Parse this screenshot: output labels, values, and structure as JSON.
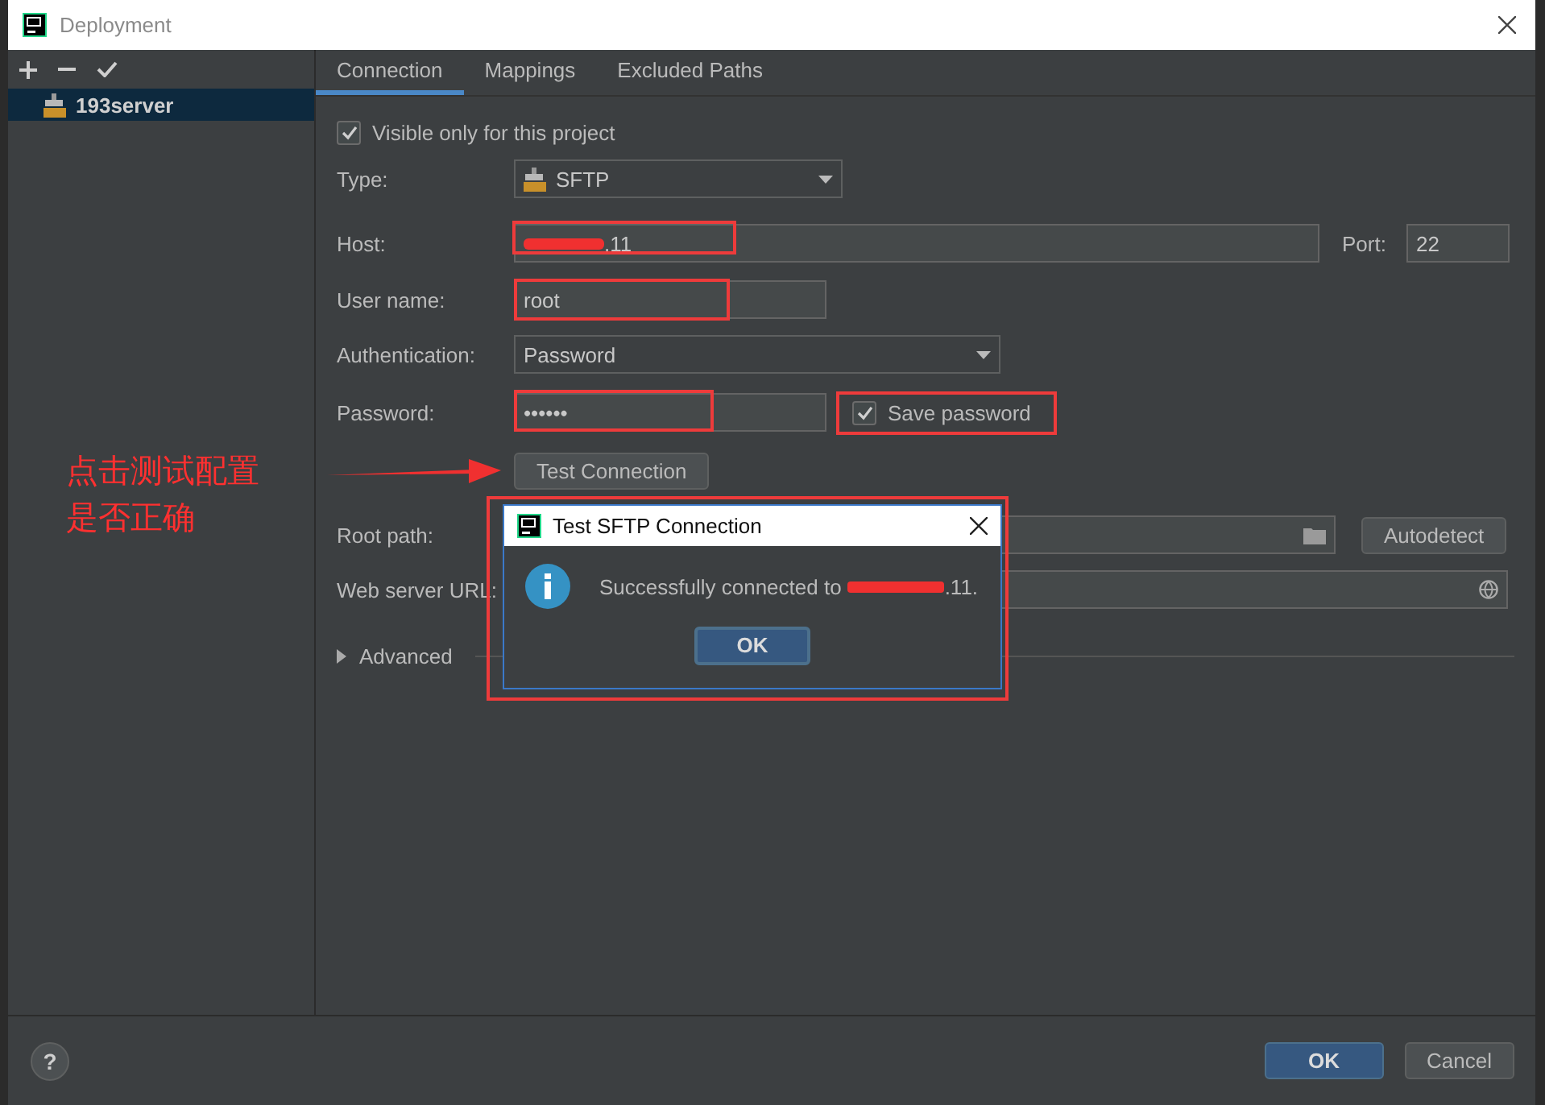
{
  "window": {
    "title": "Deployment"
  },
  "servers": [
    {
      "name": "193server",
      "selected": true
    }
  ],
  "tabs": [
    {
      "label": "Connection",
      "selected": true
    },
    {
      "label": "Mappings",
      "selected": false
    },
    {
      "label": "Excluded Paths",
      "selected": false
    }
  ],
  "form": {
    "visible_only": {
      "label": "Visible only for this project",
      "checked": true
    },
    "type": {
      "label": "Type:",
      "value": "SFTP"
    },
    "host": {
      "label": "Host:",
      "value": ".11",
      "redacted": true,
      "highlighted": true
    },
    "port": {
      "label": "Port:",
      "value": "22"
    },
    "user_name": {
      "label": "User name:",
      "value": "root",
      "highlighted": true
    },
    "authentication": {
      "label": "Authentication:",
      "value": "Password"
    },
    "password": {
      "label": "Password:",
      "value": "••••••",
      "highlighted": true
    },
    "save_password": {
      "label": "Save password",
      "checked": true,
      "highlighted": true
    },
    "test_button": "Test Connection",
    "root_path": {
      "label": "Root path:"
    },
    "autodetect_button": "Autodetect",
    "web_server_url": {
      "label": "Web server URL:"
    },
    "advanced": {
      "label": "Advanced",
      "expanded": false
    }
  },
  "dialog": {
    "title": "Test SFTP Connection",
    "message_before": "Successfully connected to",
    "redacted": true,
    "message_after": ".11.",
    "ok": "OK",
    "highlighted": true
  },
  "annotation": {
    "lines": [
      "点击测试配置",
      "是否正确"
    ]
  },
  "footer": {
    "help": "?",
    "ok": "OK",
    "cancel": "Cancel"
  }
}
